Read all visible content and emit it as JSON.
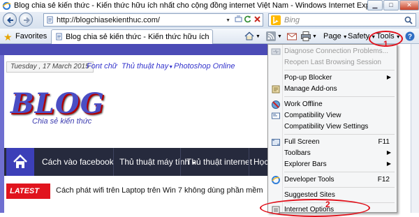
{
  "window": {
    "title": "Blog chia sẻ kiến thức - Kiến thức hữu ích nhất cho cộng đồng internet Việt Nam - Windows Internet Explorer",
    "buttons": [
      "minimize",
      "maximize",
      "close"
    ]
  },
  "addressbar": {
    "url": "http://blogchiasekienthuc.com/",
    "search_placeholder": "Bing"
  },
  "favbar": {
    "favorites_label": "Favorites",
    "tab_label": "Blog chia sẻ kiến thức - Kiến thức hữu ích nhất c...",
    "page_label": "Page",
    "safety_label": "Safety",
    "tools_label": "Tools"
  },
  "website": {
    "date": "Tuesday , 17 March 2015",
    "top_links": [
      {
        "label": "Font chữ",
        "dropdown": false
      },
      {
        "label": "Thủ thuật hay",
        "dropdown": true
      },
      {
        "label": "Photoshop Online",
        "dropdown": false
      }
    ],
    "logo_text": "BLOG",
    "logo_sub": "Chia sẻ kiến thức",
    "nav_items": [
      {
        "label": "Cách vào facebook",
        "dropdown": false
      },
      {
        "label": "Thủ thuật máy tính",
        "dropdown": true
      },
      {
        "label": "Thủ thuật internet",
        "dropdown": false
      },
      {
        "label": "Học",
        "dropdown": false
      }
    ],
    "latest_label": "LATEST POST",
    "latest_text": "Cách phát wifi trên Laptop trên Win 7 không dùng phần mềm"
  },
  "tools_menu": {
    "items": [
      {
        "label": "Diagnose Connection Problems...",
        "disabled": true,
        "icon": "diagnose-icon"
      },
      {
        "label": "Reopen Last Browsing Session",
        "disabled": true,
        "icon": ""
      },
      {
        "label": "Pop-up Blocker",
        "submenu": true,
        "icon": ""
      },
      {
        "label": "Manage Add-ons",
        "icon": "addons-icon"
      },
      {
        "label": "Work Offline",
        "icon": "work-offline-icon"
      },
      {
        "label": "Compatibility View",
        "icon": "compat-icon"
      },
      {
        "label": "Compatibility View Settings",
        "icon": ""
      },
      {
        "label": "Full Screen",
        "shortcut": "F11",
        "icon": "fullscreen-icon"
      },
      {
        "label": "Toolbars",
        "submenu": true,
        "icon": ""
      },
      {
        "label": "Explorer Bars",
        "submenu": true,
        "icon": ""
      },
      {
        "label": "Developer Tools",
        "shortcut": "F12",
        "icon": "devtools-icon"
      },
      {
        "label": "Suggested Sites",
        "icon": ""
      },
      {
        "label": "Internet Options",
        "icon": "options-icon"
      }
    ]
  },
  "annotations": {
    "step1": "1",
    "step2": "2",
    "color": "#e0101a"
  }
}
